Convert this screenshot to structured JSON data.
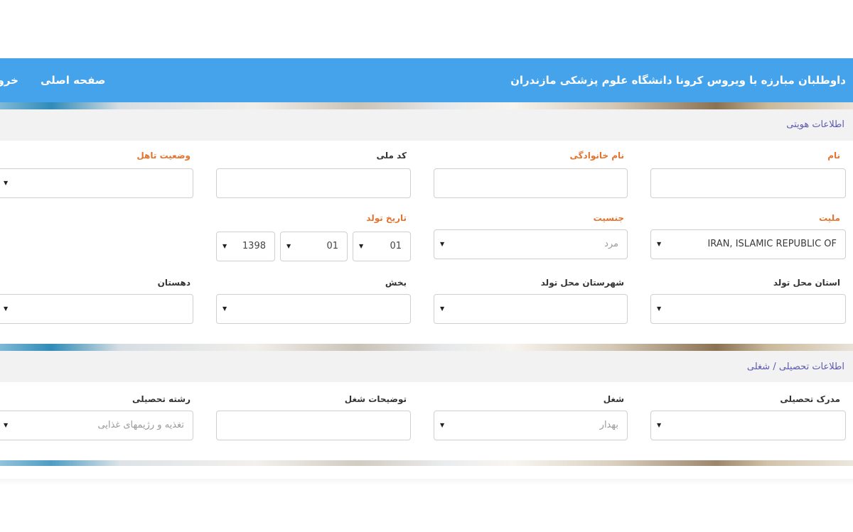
{
  "navbar": {
    "title": "داوطلبان مبارزه با ویروس کرونا دانشگاه علوم پزشکی مازندران",
    "home": "صفحه اصلی",
    "exit": "خروج"
  },
  "sections": {
    "identity": "اطلاعات هویتی",
    "education": "اطلاعات تحصیلی / شغلی"
  },
  "identity": {
    "first_name": {
      "label": "نام",
      "value": ""
    },
    "last_name": {
      "label": "نام خانوادگی",
      "value": ""
    },
    "national_code": {
      "label": "کد ملی",
      "value": ""
    },
    "marital_status": {
      "label": "وضعیت تاهل",
      "value": ""
    },
    "nationality": {
      "label": "ملیت",
      "value": "IRAN, ISLAMIC REPUBLIC OF"
    },
    "gender": {
      "label": "جنسیت",
      "value": "مرد"
    },
    "birth_date": {
      "label": "تاریخ تولد",
      "day": "01",
      "month": "01",
      "year": "1398"
    },
    "birth_province": {
      "label": "استان محل تولد",
      "value": ""
    },
    "birth_city": {
      "label": "شهرستان محل تولد",
      "value": ""
    },
    "district": {
      "label": "بخش",
      "value": ""
    },
    "rural_district": {
      "label": "دهستان",
      "value": ""
    }
  },
  "education": {
    "degree": {
      "label": "مدرک تحصیلی",
      "value": ""
    },
    "job": {
      "label": "شغل",
      "value": "بهدار"
    },
    "job_description": {
      "label": "توضیحات شغل",
      "value": ""
    },
    "field_of_study": {
      "label": "رشته تحصیلی",
      "value": "تغذیه و رژیمهای غذایی"
    }
  },
  "icons": {
    "dropdown": "triangle-down-icon"
  },
  "colors": {
    "navbar": "#45a3ec",
    "required_label": "#e3742f",
    "section_title": "#5d5ab2"
  }
}
